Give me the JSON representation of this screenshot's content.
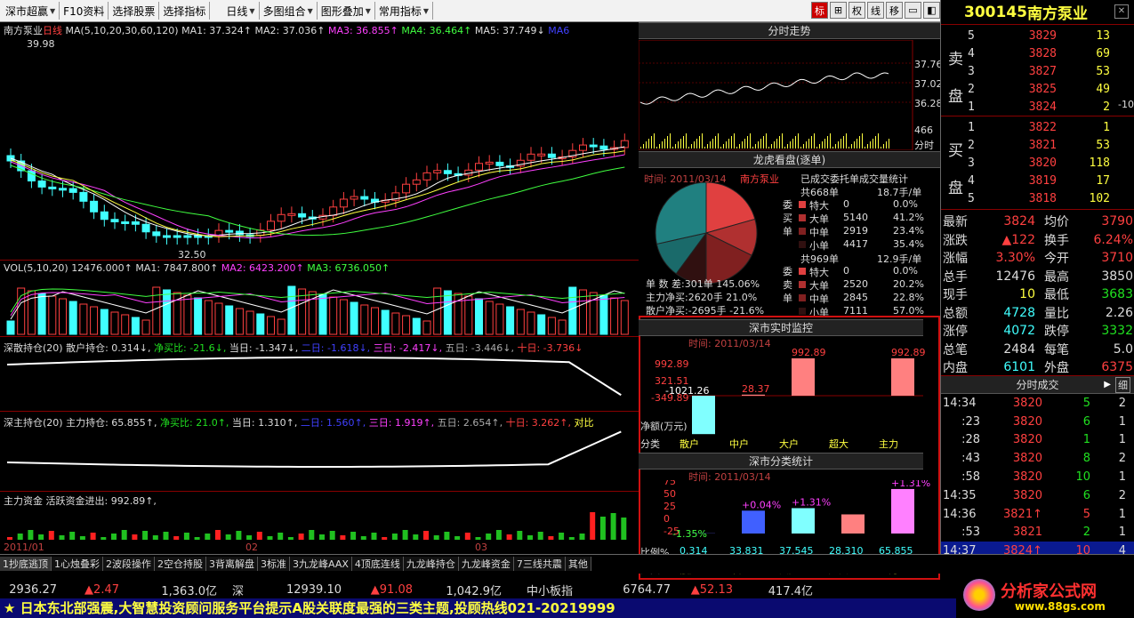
{
  "toolbar": {
    "items": [
      "深市超赢",
      "F10资料",
      "选择股票",
      "选择指标",
      "日线",
      "多图组合",
      "图形叠加",
      "常用指标"
    ],
    "right": [
      "标",
      "⊞",
      "权",
      "线",
      "移",
      "▭",
      "◧"
    ]
  },
  "kline": {
    "title": "南方泵业",
    "period": "日线",
    "ma_label": "MA(5,10,20,30,60,120)",
    "ma1": "MA1: 37.324↑",
    "ma2": "MA2: 37.036↑",
    "ma3": "MA3: 36.855↑",
    "ma4": "MA4: 36.464↑",
    "ma5": "MA5: 37.749↓",
    "ma6": "MA6",
    "high": "39.98",
    "low": "32.50"
  },
  "vol": {
    "label": "VOL(5,10,20)",
    "v": "12476.000↑",
    "ma1": "MA1: 7847.800↑",
    "ma2": "MA2: 6423.200↑",
    "ma3": "MA3: 6736.050↑"
  },
  "sh1": {
    "label": "深散持仓(20)",
    "a": "散户持仓: 0.314↓,",
    "b": "净买比: -21.6↓,",
    "c": "当日: -1.347↓,",
    "d": "二日: -1.618↓,",
    "e": "三日: -2.417↓,",
    "f": "五日: -3.446↓,",
    "g": "十日: -3.736↓"
  },
  "sh2": {
    "label": "深主持仓(20)",
    "a": "主力持仓: 65.855↑,",
    "b": "净买比: 21.0↑,",
    "c": "当日: 1.310↑,",
    "d": "二日: 1.560↑,",
    "e": "三日: 1.919↑,",
    "f": "五日: 2.654↑,",
    "g": "十日: 3.262↑,",
    "h": "对比"
  },
  "flow": {
    "label": "主力资金 活跃资金进出: 992.89↑,"
  },
  "dates": {
    "d1": "2011/01",
    "d2": "02",
    "d3": "03"
  },
  "tabs": [
    "1抄底逃顶",
    "1心烛叠彩",
    "2波段操作",
    "2空仓持股",
    "3背离解盘",
    "3标准",
    "3九龙峰AAX",
    "4顶底连线",
    "九龙峰持仓",
    "九龙峰资金",
    "7三线共震",
    "其他"
  ],
  "fenshi": {
    "title": "分时走势",
    "p1": "37.76",
    "p2": "37.02",
    "p3": "36.28",
    "v": "466",
    "lab": "分时"
  },
  "longhu": {
    "title": "龙虎看盘(逐单)",
    "date": "时间: 2011/03/14",
    "name": "南方泵业",
    "stat_title": "已成交委托单成交量统计",
    "buy_total": "共668单",
    "buy_avg": "18.7手/单",
    "sell_total": "共969单",
    "sell_avg": "12.9手/单",
    "buy_side": "委买单",
    "sell_side": "委卖单",
    "buy_rows": [
      [
        "特大",
        "0",
        "0.0%"
      ],
      [
        "大单",
        "5140",
        "41.2%"
      ],
      [
        "中单",
        "2919",
        "23.4%"
      ],
      [
        "小单",
        "4417",
        "35.4%"
      ]
    ],
    "sell_rows": [
      [
        "特大",
        "0",
        "0.0%"
      ],
      [
        "大单",
        "2520",
        "20.2%"
      ],
      [
        "中单",
        "2845",
        "22.8%"
      ],
      [
        "小单",
        "7111",
        "57.0%"
      ]
    ],
    "l1": "单 数 差:301单 145.06%",
    "l2": "主力净买:2620手 21.0%",
    "l3": "散户净买:-2695手 -21.6%",
    "colors": [
      "#e04040",
      "#b03030",
      "#802020",
      "#301010",
      "#1a6a6a",
      "#208080",
      "#40c0c0"
    ]
  },
  "monitor": {
    "title": "深市实时监控",
    "date": "时间: 2011/03/14",
    "y1": "992.89",
    "y2": "321.51",
    "y3": "-349.89",
    "y4": "-1021.26",
    "unit": "净额(万元)",
    "cat_label": "分类",
    "cats": [
      "散户",
      "中户",
      "大户",
      "超大",
      "主力"
    ],
    "values": [
      -1021.26,
      28.37,
      992.89,
      0,
      992.89
    ],
    "labels": [
      "-1021.26",
      "28.37",
      "992.89",
      "",
      "992.89"
    ]
  },
  "classify": {
    "title": "深市分类统计",
    "date": "时间: 2011/03/14",
    "y": [
      "75",
      "50",
      "25",
      "0",
      "-25"
    ],
    "ratio_label": "比例%",
    "cat_label": "分类",
    "cats": [
      "散户",
      "中户",
      "大户",
      "超大",
      "主力"
    ],
    "values": [
      0.314,
      33.831,
      37.545,
      28.31,
      65.855
    ],
    "changes": [
      "-1.35%",
      "+0.04%",
      "+1.31%",
      "",
      "+1.31%"
    ],
    "valtext": [
      "0.314",
      "33.831",
      "37.545",
      "28.310",
      "65.855"
    ]
  },
  "quote": {
    "code": "300145",
    "name": "南方泵业",
    "sell_label": [
      "卖",
      "盘"
    ],
    "buy_label": [
      "买",
      "盘"
    ],
    "asks": [
      [
        "5",
        "3829",
        "13"
      ],
      [
        "4",
        "3828",
        "69"
      ],
      [
        "3",
        "3827",
        "53"
      ],
      [
        "2",
        "3825",
        "49"
      ],
      [
        "1",
        "3824",
        "2"
      ]
    ],
    "bids": [
      [
        "1",
        "3822",
        "1"
      ],
      [
        "2",
        "3821",
        "53"
      ],
      [
        "3",
        "3820",
        "118"
      ],
      [
        "4",
        "3819",
        "17"
      ],
      [
        "5",
        "3818",
        "102"
      ]
    ],
    "ask_extra": "-10",
    "stats": [
      [
        "最新",
        "3824",
        "均价",
        "3790"
      ],
      [
        "涨跌",
        "▲122",
        "换手",
        "6.24%"
      ],
      [
        "涨幅",
        "3.30%",
        "今开",
        "3710"
      ],
      [
        "总手",
        "12476",
        "最高",
        "3850"
      ],
      [
        "现手",
        "10",
        "最低",
        "3683"
      ],
      [
        "总额",
        "4728",
        "量比",
        "2.26"
      ],
      [
        "涨停",
        "4072",
        "跌停",
        "3332"
      ],
      [
        "总笔",
        "2484",
        "每笔",
        "5.0"
      ],
      [
        "内盘",
        "6101",
        "外盘",
        "6375"
      ]
    ],
    "ticks_title": "分时成交",
    "ticks_btn": "细",
    "ticks": [
      [
        "14:34",
        "3820",
        "5",
        "2"
      ],
      [
        ":23",
        "3820",
        "6",
        "1"
      ],
      [
        ":28",
        "3820",
        "1",
        "1"
      ],
      [
        ":43",
        "3820",
        "8",
        "2"
      ],
      [
        ":58",
        "3820",
        "10",
        "1"
      ],
      [
        "14:35",
        "3820",
        "6",
        "2"
      ],
      [
        "14:36",
        "3821↑",
        "5",
        "1"
      ],
      [
        ":53",
        "3821",
        "2",
        "1"
      ],
      [
        "14:37",
        "3824↑",
        "10",
        "4"
      ]
    ]
  },
  "status": [
    [
      "2936.27",
      "white"
    ],
    [
      "▲2.47",
      "red"
    ],
    [
      "1,363.0亿",
      "white"
    ],
    [
      "深",
      "white"
    ],
    [
      "12939.10",
      "white"
    ],
    [
      "▲91.08",
      "red"
    ],
    [
      "1,042.9亿",
      "white"
    ],
    [
      "中小板指",
      "white"
    ],
    [
      "6764.77",
      "white"
    ],
    [
      "▲52.13",
      "red"
    ],
    [
      "417.4亿",
      "white"
    ]
  ],
  "ticker": "★ 日本东北部强震,大智慧投资顾问服务平台提示A股关联度最强的三类主题,投顾热线021-20219999",
  "logo": {
    "cn": "分析家公式网",
    "url": "www.88gs.com"
  }
}
